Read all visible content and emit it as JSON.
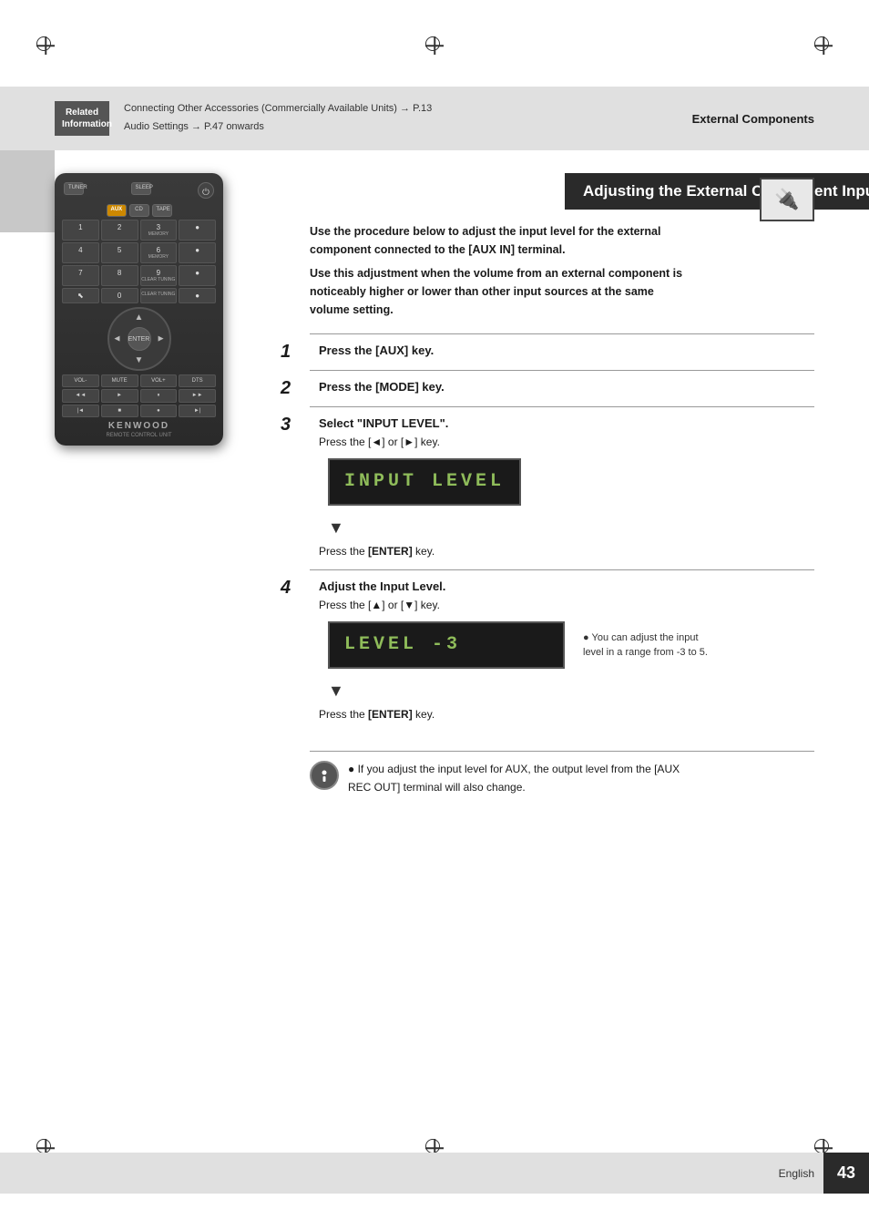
{
  "page": {
    "number": "43",
    "language": "English"
  },
  "header": {
    "section_title": "External Components",
    "related_info_label": "Related Information",
    "links": [
      "Connecting Other Accessories (Commercially Available Units) → P.13",
      "Audio Settings → P.47 onwards"
    ]
  },
  "title": "Adjusting the External Component Input Level",
  "intro": {
    "line1": "Use the procedure below to adjust the input level for the external component connected to the [AUX IN] terminal.",
    "line2": "Use this adjustment when the volume from an external component is noticeably higher or lower than other input sources at the same volume setting."
  },
  "steps": [
    {
      "number": "1",
      "title": "Press the [AUX] key.",
      "body": ""
    },
    {
      "number": "2",
      "title": "Press the [MODE] key.",
      "body": ""
    },
    {
      "number": "3",
      "title": "Select \"INPUT LEVEL\".",
      "body_line1": "Press the [◄] or [►] key.",
      "lcd": "INPUT  LEVEL",
      "body_line2": "Press the [ENTER] key."
    },
    {
      "number": "4",
      "title": "Adjust the Input Level.",
      "body_line1": "Press the [▲] or [▼] key.",
      "lcd": "LEVEL       -3",
      "note_inline": "● You can adjust the input level in a range from -3 to 5.",
      "body_line2": "Press the [ENTER] key."
    }
  ],
  "note": {
    "text": "● If you adjust the input level for AUX, the output level from the [AUX REC OUT] terminal will also change."
  },
  "remote": {
    "brand": "KENWOOD",
    "model": "REMOTE CONTROL UNIT"
  }
}
